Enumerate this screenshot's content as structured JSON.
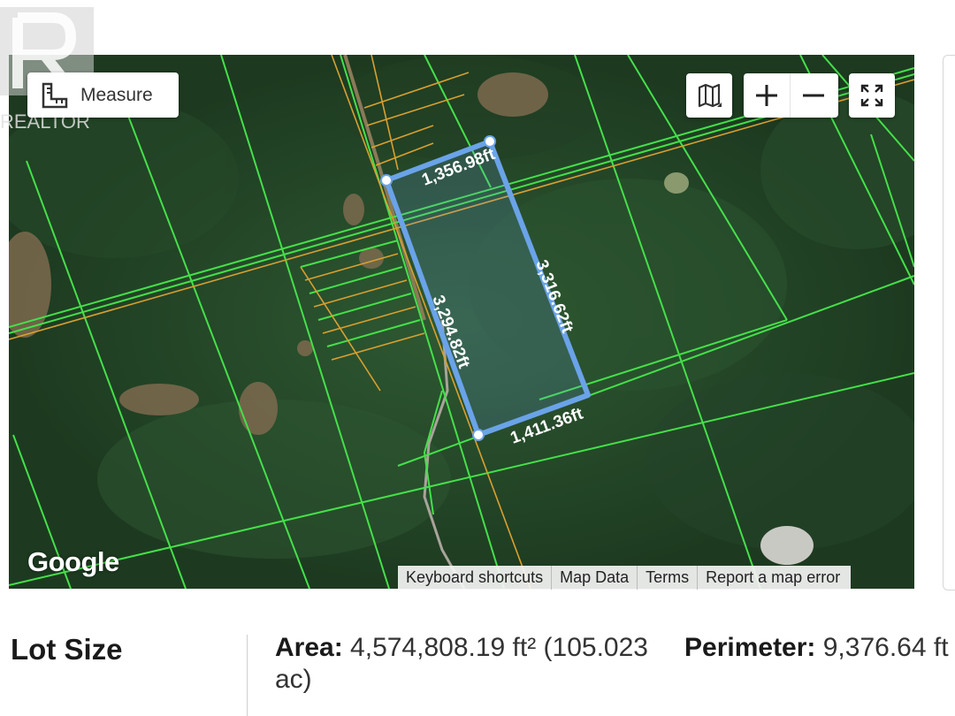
{
  "watermark": {
    "text": "REALTOR",
    "mark": "®"
  },
  "map": {
    "measure_button": {
      "label": "Measure",
      "icon": "ruler-square-icon"
    },
    "controls": {
      "layers_icon": "map-layers-icon",
      "zoom_in_icon": "plus-icon",
      "zoom_out_icon": "minus-icon",
      "fullscreen_icon": "fullscreen-icon"
    },
    "google_logo": "Google",
    "attribution": [
      "Keyboard shortcuts",
      "Map Data",
      "Terms",
      "Report a map error"
    ],
    "measurements": [
      "1,356.98ft",
      "3,316.62ft",
      "1,411.36ft",
      "3,294.82ft"
    ],
    "measurement_color": "#6aa3e8",
    "parcel_line_color": "#45e04a",
    "lot_line_color": "#d9a030"
  },
  "lot": {
    "heading": "Lot Size",
    "area_label": "Area:",
    "area_value": "4,574,808.19 ft² (105.023",
    "area_value_cont": "ac)",
    "perimeter_label": "Perimeter:",
    "perimeter_value": "9,376.64 ft"
  }
}
